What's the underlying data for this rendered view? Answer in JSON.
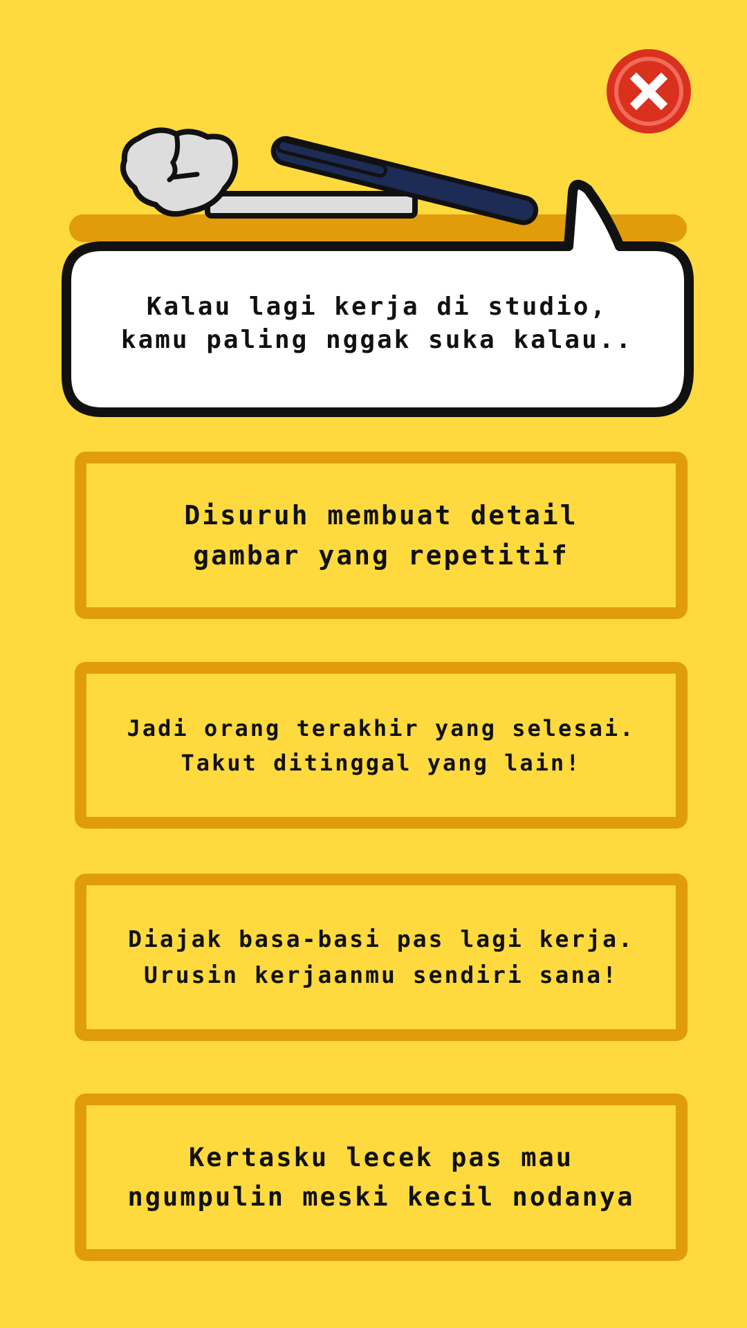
{
  "colors": {
    "background": "#FEDA3E",
    "option_border": "#E09C0B",
    "close_button": "#D9311E"
  },
  "icons": {
    "close": "close-icon",
    "illustration": "crumpled-paper-and-pen-illustration"
  },
  "question": {
    "text": "Kalau lagi kerja di studio,\nkamu paling nggak suka kalau.."
  },
  "options": [
    {
      "text": "Disuruh membuat detail\ngambar yang repetitif"
    },
    {
      "text": "Jadi orang terakhir yang selesai.\nTakut ditinggal yang lain!"
    },
    {
      "text": "Diajak basa-basi pas lagi kerja.\nUrusin kerjaanmu sendiri sana!"
    },
    {
      "text": "Kertasku lecek pas mau\nngumpulin meski kecil nodanya"
    }
  ]
}
